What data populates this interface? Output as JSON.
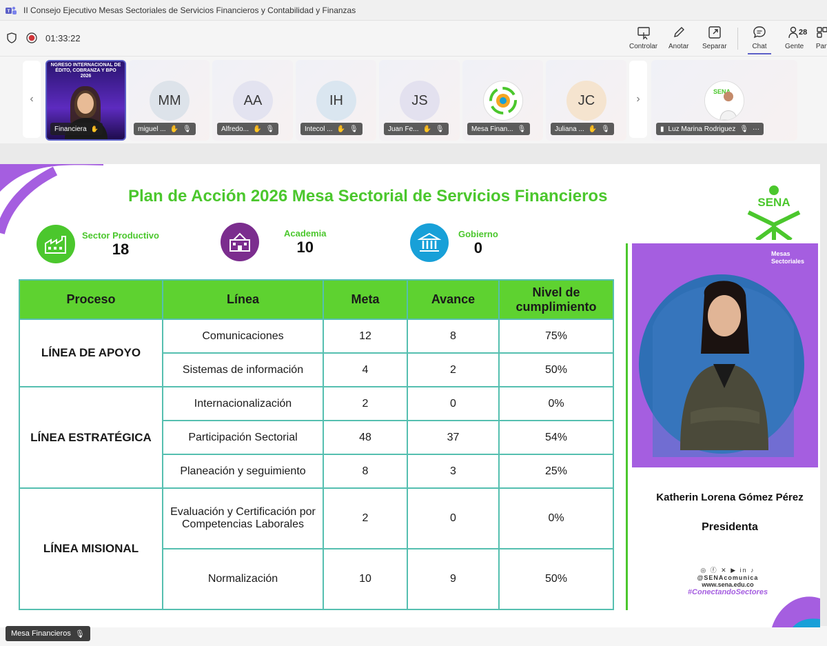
{
  "window": {
    "title": "II Consejo Ejecutivo Mesas Sectoriales de Servicios Financieros y Contabilidad y Finanzas"
  },
  "toolbar": {
    "timer": "01:33:22",
    "buttons": [
      {
        "label": "Controlar",
        "icon": "control-icon"
      },
      {
        "label": "Anotar",
        "icon": "pen-icon"
      },
      {
        "label": "Separar",
        "icon": "popout-icon"
      },
      {
        "label": "Chat",
        "icon": "chat-icon"
      },
      {
        "label": "Gente",
        "icon": "people-icon",
        "count": "28"
      },
      {
        "label": "Part",
        "icon": "more-icon"
      }
    ]
  },
  "participants": [
    {
      "name": "Financiera",
      "type": "video",
      "slide_text": "NGRESO INTERNACIONAL DE\nÉDITO, COBRANZA Y BPO\n2026"
    },
    {
      "name": "miguel ...",
      "initials": "MM",
      "avatar_color": "#dde3ea"
    },
    {
      "name": "Alfredo...",
      "initials": "AA",
      "avatar_color": "#e3e3f0"
    },
    {
      "name": "Intecol ...",
      "initials": "IH",
      "avatar_color": "#dae6f0"
    },
    {
      "name": "Juan Fe...",
      "initials": "JS",
      "avatar_color": "#e3e1ef"
    },
    {
      "name": "Mesa Finan...",
      "type": "logo"
    },
    {
      "name": "Juliana ...",
      "initials": "JC",
      "avatar_color": "#f5e4cf"
    },
    {
      "name": "Luz Marina Rodriguez",
      "type": "photo"
    }
  ],
  "slide": {
    "title": "Plan de Acción 2026 Mesa Sectorial de Servicios Financieros",
    "stats": [
      {
        "label": "Sector Productivo",
        "value": "18",
        "color": "#4bc72d",
        "icon": "factory-icon"
      },
      {
        "label": "Academia",
        "value": "10",
        "color": "#7b2d8e",
        "icon": "school-icon"
      },
      {
        "label": "Gobierno",
        "value": "0",
        "color": "#18a0d8",
        "icon": "government-icon"
      }
    ],
    "table": {
      "headers": [
        "Proceso",
        "Línea",
        "Meta",
        "Avance",
        "Nivel de cumplimiento"
      ],
      "groups": [
        {
          "proceso": "LÍNEA DE APOYO",
          "rows": [
            {
              "linea": "Comunicaciones",
              "meta": "12",
              "avance": "8",
              "nivel": "75%"
            },
            {
              "linea": "Sistemas de información",
              "meta": "4",
              "avance": "2",
              "nivel": "50%"
            }
          ]
        },
        {
          "proceso": "LÍNEA ESTRATÉGICA",
          "rows": [
            {
              "linea": "Internacionalización",
              "meta": "2",
              "avance": "0",
              "nivel": "0%"
            },
            {
              "linea": "Participación Sectorial",
              "meta": "48",
              "avance": "37",
              "nivel": "54%"
            },
            {
              "linea": "Planeación y seguimiento",
              "meta": "8",
              "avance": "3",
              "nivel": "25%"
            }
          ]
        },
        {
          "proceso": "LÍNEA MISIONAL",
          "rows": [
            {
              "linea": "Evaluación y Certificación por Competencias Laborales",
              "meta": "2",
              "avance": "0",
              "nivel": "0%"
            },
            {
              "linea": "Normalización",
              "meta": "10",
              "avance": "9",
              "nivel": "50%"
            }
          ]
        }
      ]
    },
    "logo_text": "SENA",
    "mesas_label": "Mesas Sectoriales",
    "presenter": {
      "name": "Katherin Lorena Gómez Pérez",
      "role": "Presidenta"
    },
    "social": {
      "handle": "@SENAcomunica",
      "website": "www.sena.edu.co",
      "hashtag": "#ConectandoSectores"
    }
  },
  "active_speaker": "Mesa Financieros",
  "colors": {
    "sena_green": "#4bc72d",
    "teams_purple": "#5b5fc7",
    "sena_purple": "#a55ee0"
  }
}
